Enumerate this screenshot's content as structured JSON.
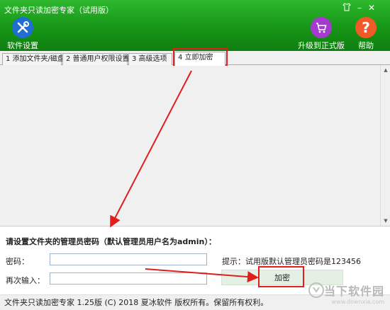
{
  "window": {
    "title": "文件夹只读加密专家（试用版）"
  },
  "toolbar": {
    "settings_label": "软件设置",
    "upgrade_label": "升级到正式版",
    "help_label": "帮助"
  },
  "tabs": [
    {
      "label": "1 添加文件夹/磁盘"
    },
    {
      "label": "2 普通用户权限设置"
    },
    {
      "label": "3 高级选项"
    },
    {
      "label": "4 立即加密"
    }
  ],
  "form": {
    "heading": "请设置文件夹的管理员密码（默认管理员用户名为admin）：",
    "password_label": "密码：",
    "password_value": "",
    "confirm_label": "再次输入：",
    "confirm_value": "",
    "hint": "提示：试用版默认管理员密码是123456",
    "encrypt_label": "加密"
  },
  "status": {
    "text": "文件夹只读加密专家  1.25版 (C) 2018 夏冰软件 版权所有。保留所有权利。"
  },
  "colors": {
    "title_green": "#169516",
    "annotation_red": "#e11d1d",
    "upgrade_purple": "#a53ad0",
    "help_orange": "#f05a28"
  },
  "icons": {
    "settings": "wrench-screwdriver-icon",
    "upgrade": "cart-icon",
    "help": "question-icon"
  },
  "watermark": {
    "cn": "当下软件园",
    "en": "www.downxia.com"
  }
}
